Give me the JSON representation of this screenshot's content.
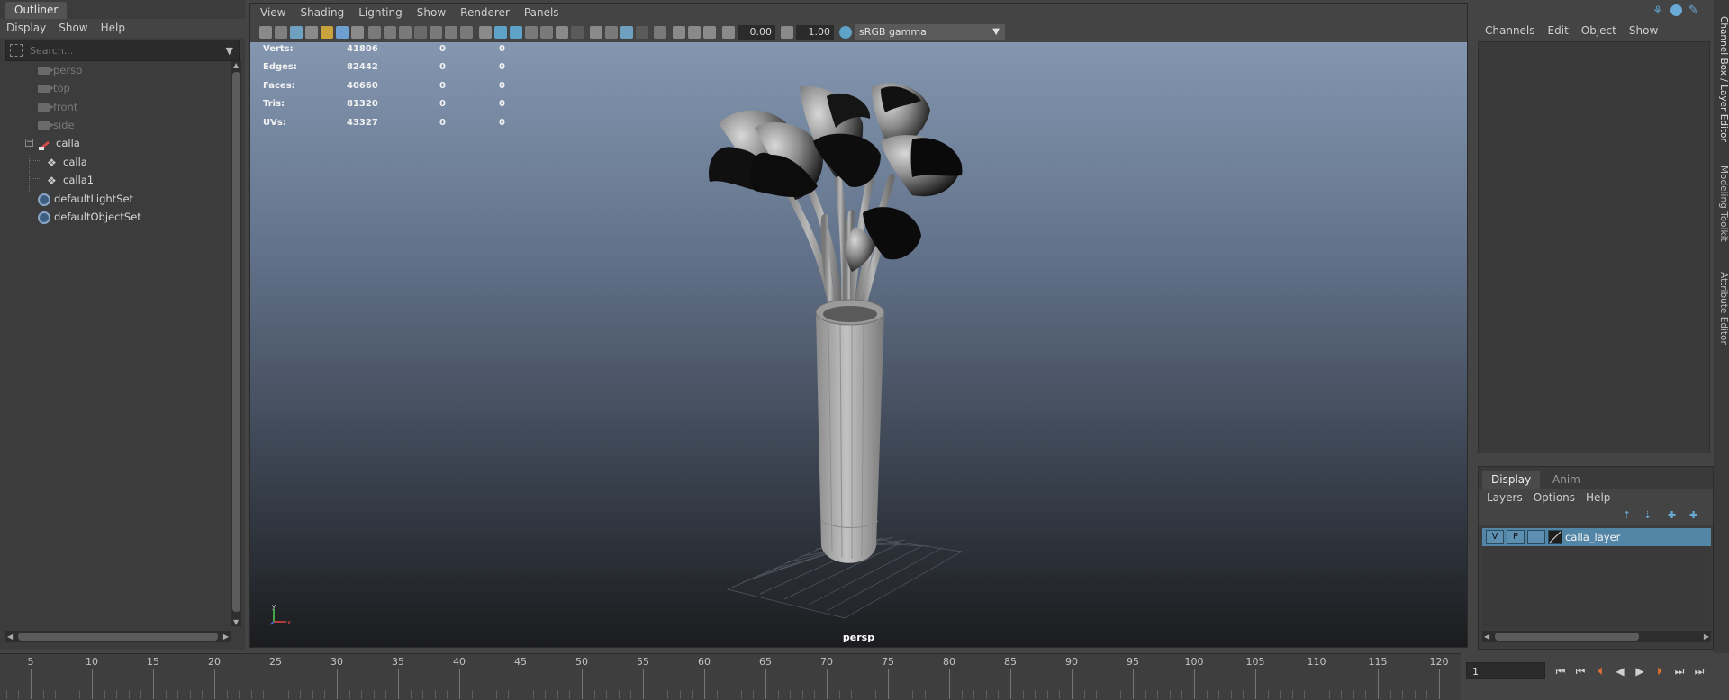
{
  "outliner": {
    "tab_label": "Outliner",
    "menu": [
      "Display",
      "Show",
      "Help"
    ],
    "search_placeholder": "Search...",
    "items": [
      {
        "label": "persp",
        "icon": "camera-icon",
        "dimmed": true
      },
      {
        "label": "top",
        "icon": "camera-icon",
        "dimmed": true
      },
      {
        "label": "front",
        "icon": "camera-icon",
        "dimmed": true
      },
      {
        "label": "side",
        "icon": "camera-icon",
        "dimmed": true
      },
      {
        "label": "calla",
        "icon": "group-icon",
        "dimmed": false
      },
      {
        "label": "calla",
        "icon": "mesh-icon",
        "dimmed": false
      },
      {
        "label": "calla1",
        "icon": "mesh-icon",
        "dimmed": false
      },
      {
        "label": "defaultLightSet",
        "icon": "set-icon",
        "dimmed": false
      },
      {
        "label": "defaultObjectSet",
        "icon": "set-icon",
        "dimmed": false
      }
    ],
    "expander_symbol": "−"
  },
  "viewport": {
    "menu": [
      "View",
      "Shading",
      "Lighting",
      "Show",
      "Renderer",
      "Panels"
    ],
    "exposure": "0.00",
    "gamma": "1.00",
    "color_space": "sRGB gamma",
    "camera_name": "persp",
    "hud": [
      {
        "label": "Verts:",
        "values": [
          "41806",
          "0",
          "0"
        ]
      },
      {
        "label": "Edges:",
        "values": [
          "82442",
          "0",
          "0"
        ]
      },
      {
        "label": "Faces:",
        "values": [
          "40660",
          "0",
          "0"
        ]
      },
      {
        "label": "Tris:",
        "values": [
          "81320",
          "0",
          "0"
        ]
      },
      {
        "label": "UVs:",
        "values": [
          "43327",
          "0",
          "0"
        ]
      }
    ],
    "axis_labels": {
      "y": "y",
      "x": "x"
    }
  },
  "channel_box": {
    "menu": [
      "Channels",
      "Edit",
      "Object",
      "Show"
    ]
  },
  "side_tabs": [
    "Channel Box / Layer Editor",
    "Modeling Toolkit",
    "Attribute Editor"
  ],
  "layer_editor": {
    "tabs": [
      "Display",
      "Anim"
    ],
    "menu": [
      "Layers",
      "Options",
      "Help"
    ],
    "layer": {
      "visible": "V",
      "playback": "P",
      "name": "calla_layer"
    }
  },
  "time_slider": {
    "ticks": [
      "5",
      "10",
      "15",
      "20",
      "25",
      "30",
      "35",
      "40",
      "45",
      "50",
      "55",
      "60",
      "65",
      "70",
      "75",
      "80",
      "85",
      "90",
      "95",
      "100",
      "105",
      "110",
      "115",
      "120"
    ],
    "current_frame": "1"
  },
  "colors": {
    "accent": "#5285a6",
    "active_button": "#5fa2c8",
    "viewport_top": "#8496b0",
    "viewport_bottom": "#1b1c1e"
  }
}
